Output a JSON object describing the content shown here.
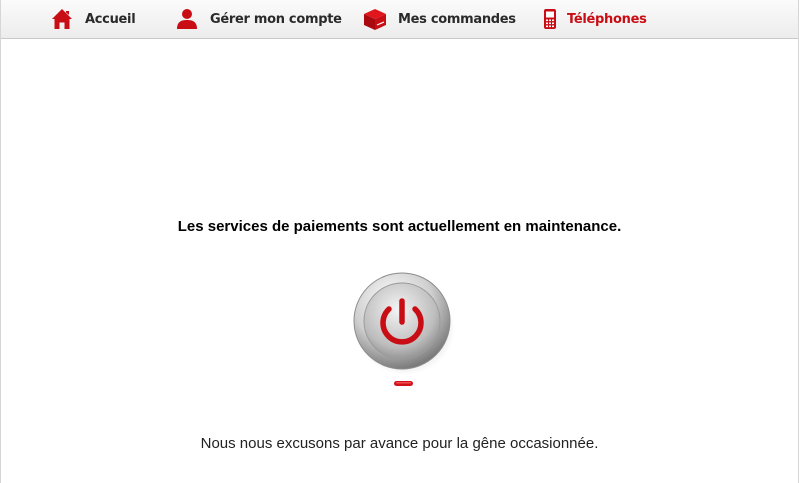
{
  "nav": {
    "items": [
      {
        "label": "Accueil",
        "icon": "home-icon",
        "active": false
      },
      {
        "label": "Gérer mon compte",
        "icon": "user-icon",
        "active": false
      },
      {
        "label": "Mes commandes",
        "icon": "box-icon",
        "active": false
      },
      {
        "label": "Téléphones",
        "icon": "phone-icon",
        "active": true
      }
    ]
  },
  "main": {
    "maintenance_message": "Les services de paiements sont actuellement en maintenance.",
    "power_icon": "power-icon",
    "apology": "Nous nous excusons par avance pour la gêne occasionnée."
  },
  "colors": {
    "accent": "#c80e14",
    "nav_text": "#2a2a2a"
  }
}
